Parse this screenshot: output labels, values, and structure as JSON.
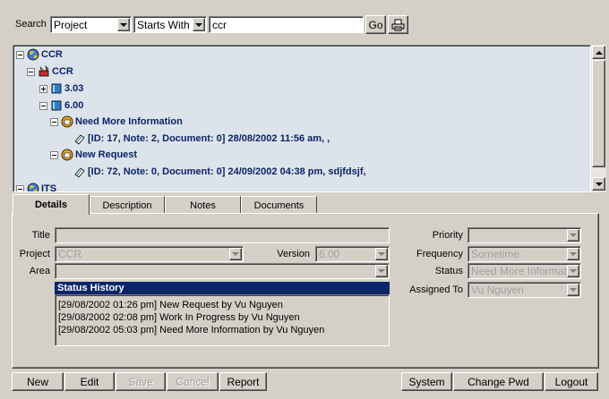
{
  "search": {
    "label": "Search",
    "field_value": "Project",
    "match_value": "Starts With",
    "query": "ccr",
    "go_label": "Go"
  },
  "tree": {
    "nodes": [
      {
        "label": "CCR"
      },
      {
        "label": "CCR"
      },
      {
        "label": "3.03"
      },
      {
        "label": "6.00"
      },
      {
        "label": "Need More Information"
      },
      {
        "label": "[ID: 17, Note: 2, Document: 0] 28/08/2002 11:56 am, ,"
      },
      {
        "label": "New Request"
      },
      {
        "label": "[ID: 72, Note: 0, Document: 0] 24/09/2002 04:38 pm, sdjfdsjf,"
      },
      {
        "label": "ITS"
      }
    ]
  },
  "tabs": [
    {
      "label": "Details"
    },
    {
      "label": "Description"
    },
    {
      "label": "Notes"
    },
    {
      "label": "Documents"
    }
  ],
  "details": {
    "title_label": "Title",
    "project_label": "Project",
    "project_value": "CCR",
    "version_label": "Version",
    "version_value": "6.00",
    "area_label": "Area",
    "priority_label": "Priority",
    "frequency_label": "Frequency",
    "frequency_value": "Sometime",
    "status_label": "Status",
    "status_value": "Need More Informatio",
    "assigned_label": "Assigned To",
    "assigned_value": "Vu Nguyen"
  },
  "history": {
    "title": "Status History",
    "entries": [
      "[29/08/2002 01:26 pm] New Request by Vu Nguyen",
      "[29/08/2002 02:08 pm] Work In Progress by Vu Nguyen",
      "[29/08/2002 05:03 pm] Need More Information by Vu Nguyen"
    ]
  },
  "toolbar": {
    "new": "New",
    "edit": "Edit",
    "save": "Save",
    "cancel": "Cancel",
    "report": "Report",
    "system": "System",
    "change_pwd": "Change Pwd",
    "logout": "Logout"
  }
}
